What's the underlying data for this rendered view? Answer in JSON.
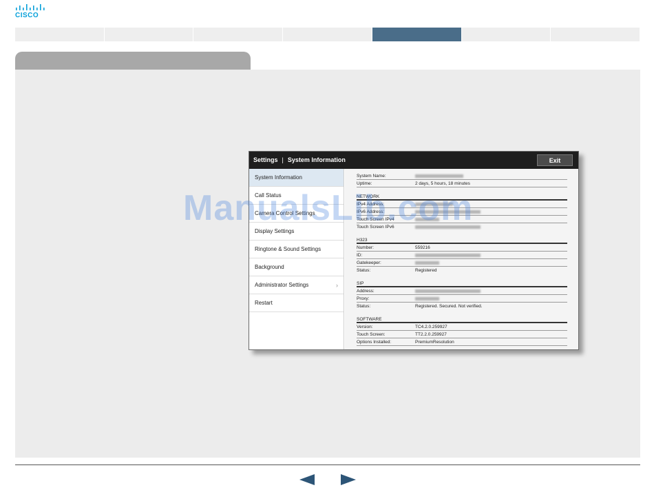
{
  "brand": {
    "logo_text": "CISCO",
    "color": "#049fd9"
  },
  "top_nav": {
    "tab_count": 7,
    "active_index": 4,
    "active_color": "#4a6d89"
  },
  "panel": {
    "breadcrumb_root": "Settings",
    "breadcrumb_separator": "|",
    "breadcrumb_current": "System Information",
    "exit_label": "Exit",
    "menu": [
      {
        "label": "System Information",
        "active": true
      },
      {
        "label": "Call Status"
      },
      {
        "label": "Camera Control Settings"
      },
      {
        "label": "Display Settings"
      },
      {
        "label": "Ringtone & Sound Settings"
      },
      {
        "label": "Background"
      },
      {
        "label": "Administrator Settings",
        "chevron": "›"
      },
      {
        "label": "Restart"
      }
    ],
    "system": {
      "name_label": "System Name:",
      "uptime_label": "Uptime:",
      "uptime_value": "2 days, 5 hours, 18 minutes"
    },
    "network": {
      "heading": "NETWORK",
      "ipv4_label": "IPv4 Address:",
      "ipv6_label": "IPv6 Address:",
      "touch_ipv4_label": "Touch Screen IPv4",
      "touch_ipv6_label": "Touch Screen IPv6"
    },
    "h323": {
      "heading": "H323",
      "number_label": "Number:",
      "number_value": "559216",
      "id_label": "ID:",
      "gatekeeper_label": "Gatekeeper:",
      "status_label": "Status:",
      "status_value": "Registered"
    },
    "sip": {
      "heading": "SIP",
      "address_label": "Address:",
      "proxy_label": "Proxy:",
      "status_label": "Status:",
      "status_value": "Registered. Secured. Not verified."
    },
    "software": {
      "heading": "SOFTWARE",
      "version_label": "Version:",
      "version_value": "TC4.2.0.259927",
      "touch_label": "Touch Screen:",
      "touch_value": "TT2.2.0.259927",
      "options_label": "Options Installed:",
      "options_value": "PremiumResolution"
    }
  },
  "watermark": "ManualsLib.com",
  "footer": {
    "prev_icon": "triangle-left",
    "next_icon": "triangle-right",
    "arrow_color": "#2d5577"
  }
}
